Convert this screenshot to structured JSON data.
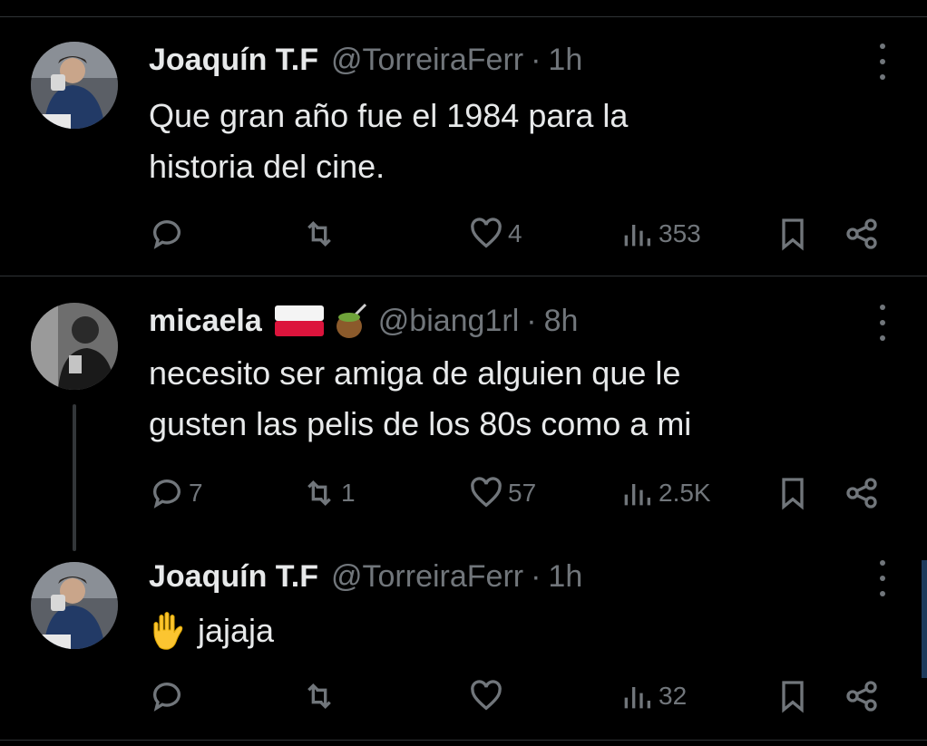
{
  "colors": {
    "background": "#000000",
    "primary_text": "#e7e9ea",
    "secondary_text": "#71767b",
    "divider": "#2f3336"
  },
  "tweets": [
    {
      "name": "Joaquín T.F",
      "handle": "@TorreiraFerr",
      "separator": "·",
      "time": "1h",
      "text": "Que gran año fue el 1984 para la\nhistoria del cine.",
      "replies": "",
      "retweets": "",
      "likes": "4",
      "views": "353",
      "avatar_icon": "person-photo-avatar"
    },
    {
      "name": "micaela",
      "emojis": [
        "poland-flag-icon",
        "mate-icon"
      ],
      "handle": "@biang1rl",
      "separator": "·",
      "time": "8h",
      "text": "necesito ser amiga de alguien que le\ngusten las pelis de los 80s como a mi",
      "replies": "7",
      "retweets": "1",
      "likes": "57",
      "views": "2.5K",
      "avatar_icon": "person-photo-avatar"
    },
    {
      "name": "Joaquín T.F",
      "handle": "@TorreiraFerr",
      "separator": "·",
      "time": "1h",
      "text": "jajaja",
      "text_emoji": "raised-hand-icon",
      "replies": "",
      "retweets": "",
      "likes": "",
      "views": "32",
      "avatar_icon": "person-photo-avatar"
    }
  ]
}
